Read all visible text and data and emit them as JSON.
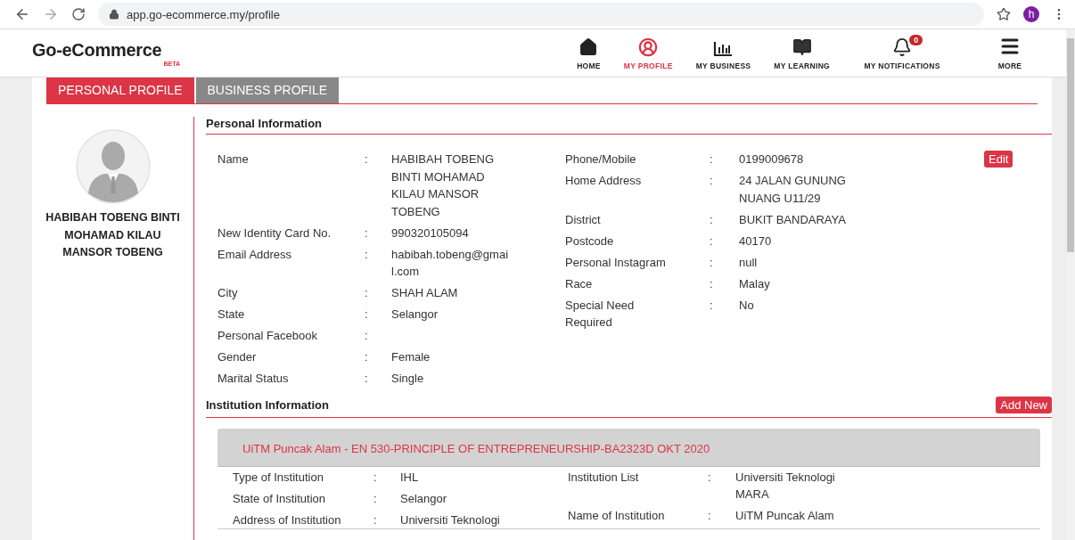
{
  "browser": {
    "url": "app.go-ecommerce.my/profile",
    "profile_initial": "h"
  },
  "header": {
    "logo": "Go-eCommerce",
    "logo_badge": "BETA",
    "nav": [
      {
        "kind": "home",
        "label": "HOME",
        "selected": false
      },
      {
        "kind": "profile",
        "label": "MY PROFILE",
        "selected": true
      },
      {
        "kind": "business",
        "label": "MY BUSINESS",
        "selected": false
      },
      {
        "kind": "learning",
        "label": "MY LEARNING",
        "selected": false
      },
      {
        "kind": "notifications",
        "label": "MY NOTIFICATIONS",
        "selected": false,
        "badge": "0"
      },
      {
        "kind": "more",
        "label": "MORE",
        "selected": false
      }
    ]
  },
  "tabs": [
    {
      "label": "PERSONAL PROFILE",
      "selected": true
    },
    {
      "label": "BUSINESS PROFILE",
      "selected": false
    }
  ],
  "profile": {
    "name": "HABIBAH TOBENG BINTI MOHAMAD KILAU MANSOR TOBENG"
  },
  "personal_information": {
    "title": "Personal Information",
    "edit_button": "Edit",
    "left": [
      {
        "label": "Name",
        "colon": ":",
        "value": "HABIBAH TOBENG BINTI MOHAMAD KILAU MANSOR TOBENG"
      },
      {
        "label": "New Identity Card No.",
        "colon": ":",
        "value": "990320105094"
      },
      {
        "label": "Email Address",
        "colon": ":",
        "value": "habibah.tobeng@gmail.com"
      },
      {
        "label": "City",
        "colon": ":",
        "value": "SHAH ALAM"
      },
      {
        "label": "State",
        "colon": ":",
        "value": "Selangor"
      },
      {
        "label": "Personal Facebook",
        "colon": ":"
      },
      {
        "label": "Gender",
        "colon": ":",
        "value": "Female"
      },
      {
        "label": "Marital Status",
        "colon": ":",
        "value": "Single"
      }
    ],
    "right": [
      {
        "label": "Phone/Mobile",
        "colon": ":",
        "value": "0199009678"
      },
      {
        "label": "Home Address",
        "colon": ":",
        "value": "24 JALAN GUNUNG NUANG U11/29"
      },
      {
        "label": "District",
        "colon": ":",
        "value": "BUKIT BANDARAYA"
      },
      {
        "label": "Postcode",
        "colon": ":",
        "value": "40170"
      },
      {
        "label": "Personal Instagram",
        "colon": ":",
        "value": "null"
      },
      {
        "label": "Race",
        "colon": ":",
        "value": "Malay"
      },
      {
        "label": "Special Need Required",
        "colon": ":",
        "value": "No"
      }
    ]
  },
  "institution_information": {
    "title": "Institution Information",
    "add_button": "Add New",
    "institutions": [
      {
        "title": "UiTM Puncak Alam - EN 530-PRINCIPLE OF ENTREPRENEURSHIP-BA2323D OKT 2020",
        "left": [
          {
            "label": "Type of Institution",
            "colon": ":",
            "value": "IHL"
          },
          {
            "label": "State of Institution",
            "colon": ":",
            "value": "Selangor"
          },
          {
            "label": "Address of Institution",
            "colon": ":",
            "value": "Universiti Teknologi"
          }
        ],
        "right": [
          {
            "label": "Institution List",
            "colon": ":",
            "value": "Universiti Teknologi MARA"
          },
          {
            "label": "Name of Institution",
            "colon": ":",
            "value": "UiTM Puncak Alam"
          }
        ]
      }
    ]
  }
}
